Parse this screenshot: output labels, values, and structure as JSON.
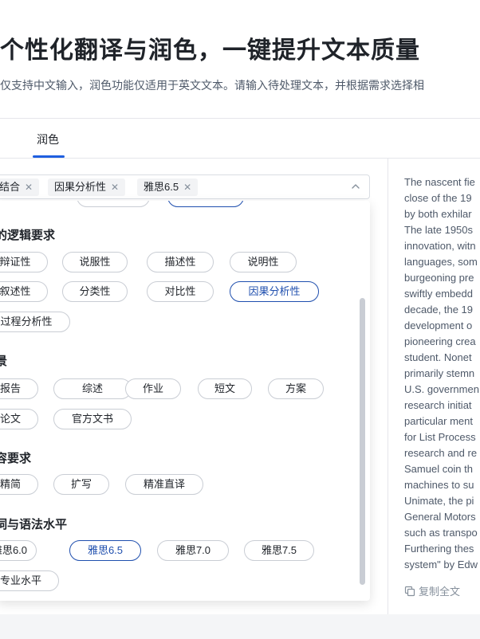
{
  "header": {
    "title": "个性化翻译与润色，一键提升文本质量",
    "subtitle": "仅支持中文输入，润色功能仅适用于英文文本。请输入待处理文本，并根据需求选择相"
  },
  "tabs": [
    {
      "label": "润色",
      "active": true
    }
  ],
  "selector": {
    "tags": [
      {
        "label": "结合"
      },
      {
        "label": "因果分析性"
      },
      {
        "label": "雅思6.5"
      }
    ],
    "chevron_icon": "chevron-up-icon"
  },
  "groups": [
    {
      "title": "的逻辑要求",
      "options": [
        "辩证性",
        "说服性",
        "描述性",
        "说明性",
        "叙述性",
        "分类性",
        "对比性",
        "因果分析性",
        "过程分析性"
      ],
      "selected": "因果分析性"
    },
    {
      "title": "景",
      "options": [
        "报告",
        "综述",
        "作业",
        "短文",
        "方案",
        "论文",
        "官方文书"
      ]
    },
    {
      "title": "容要求",
      "options": [
        "精简",
        "扩写",
        "精准直译"
      ]
    },
    {
      "title": "词与语法水平",
      "options": [
        "雅思6.0",
        "雅思6.5",
        "雅思7.0",
        "雅思7.5",
        "专业水平"
      ],
      "selected": "雅思6.5"
    }
  ],
  "result": {
    "lines": [
      "The nascent fie",
      "close of the 19",
      "by both exhilar",
      "The late 1950s",
      "innovation, witn",
      "languages, som",
      "burgeoning pre",
      "swiftly embedd",
      "decade, the 19",
      "development o",
      "pioneering crea",
      "student. Nonet",
      "primarily stemn",
      "U.S. governmen",
      "research initiat",
      "particular ment",
      "for List Process",
      "research and re",
      "Samuel coin th",
      "machines to su",
      "Unimate, the pi",
      "General Motors",
      "such as transpo",
      "Furthering thes",
      "system\" by Edw"
    ],
    "copy_label": "复制全文"
  },
  "colors": {
    "accent": "#1f5fe0",
    "selected_chip": "#1f4fae"
  }
}
